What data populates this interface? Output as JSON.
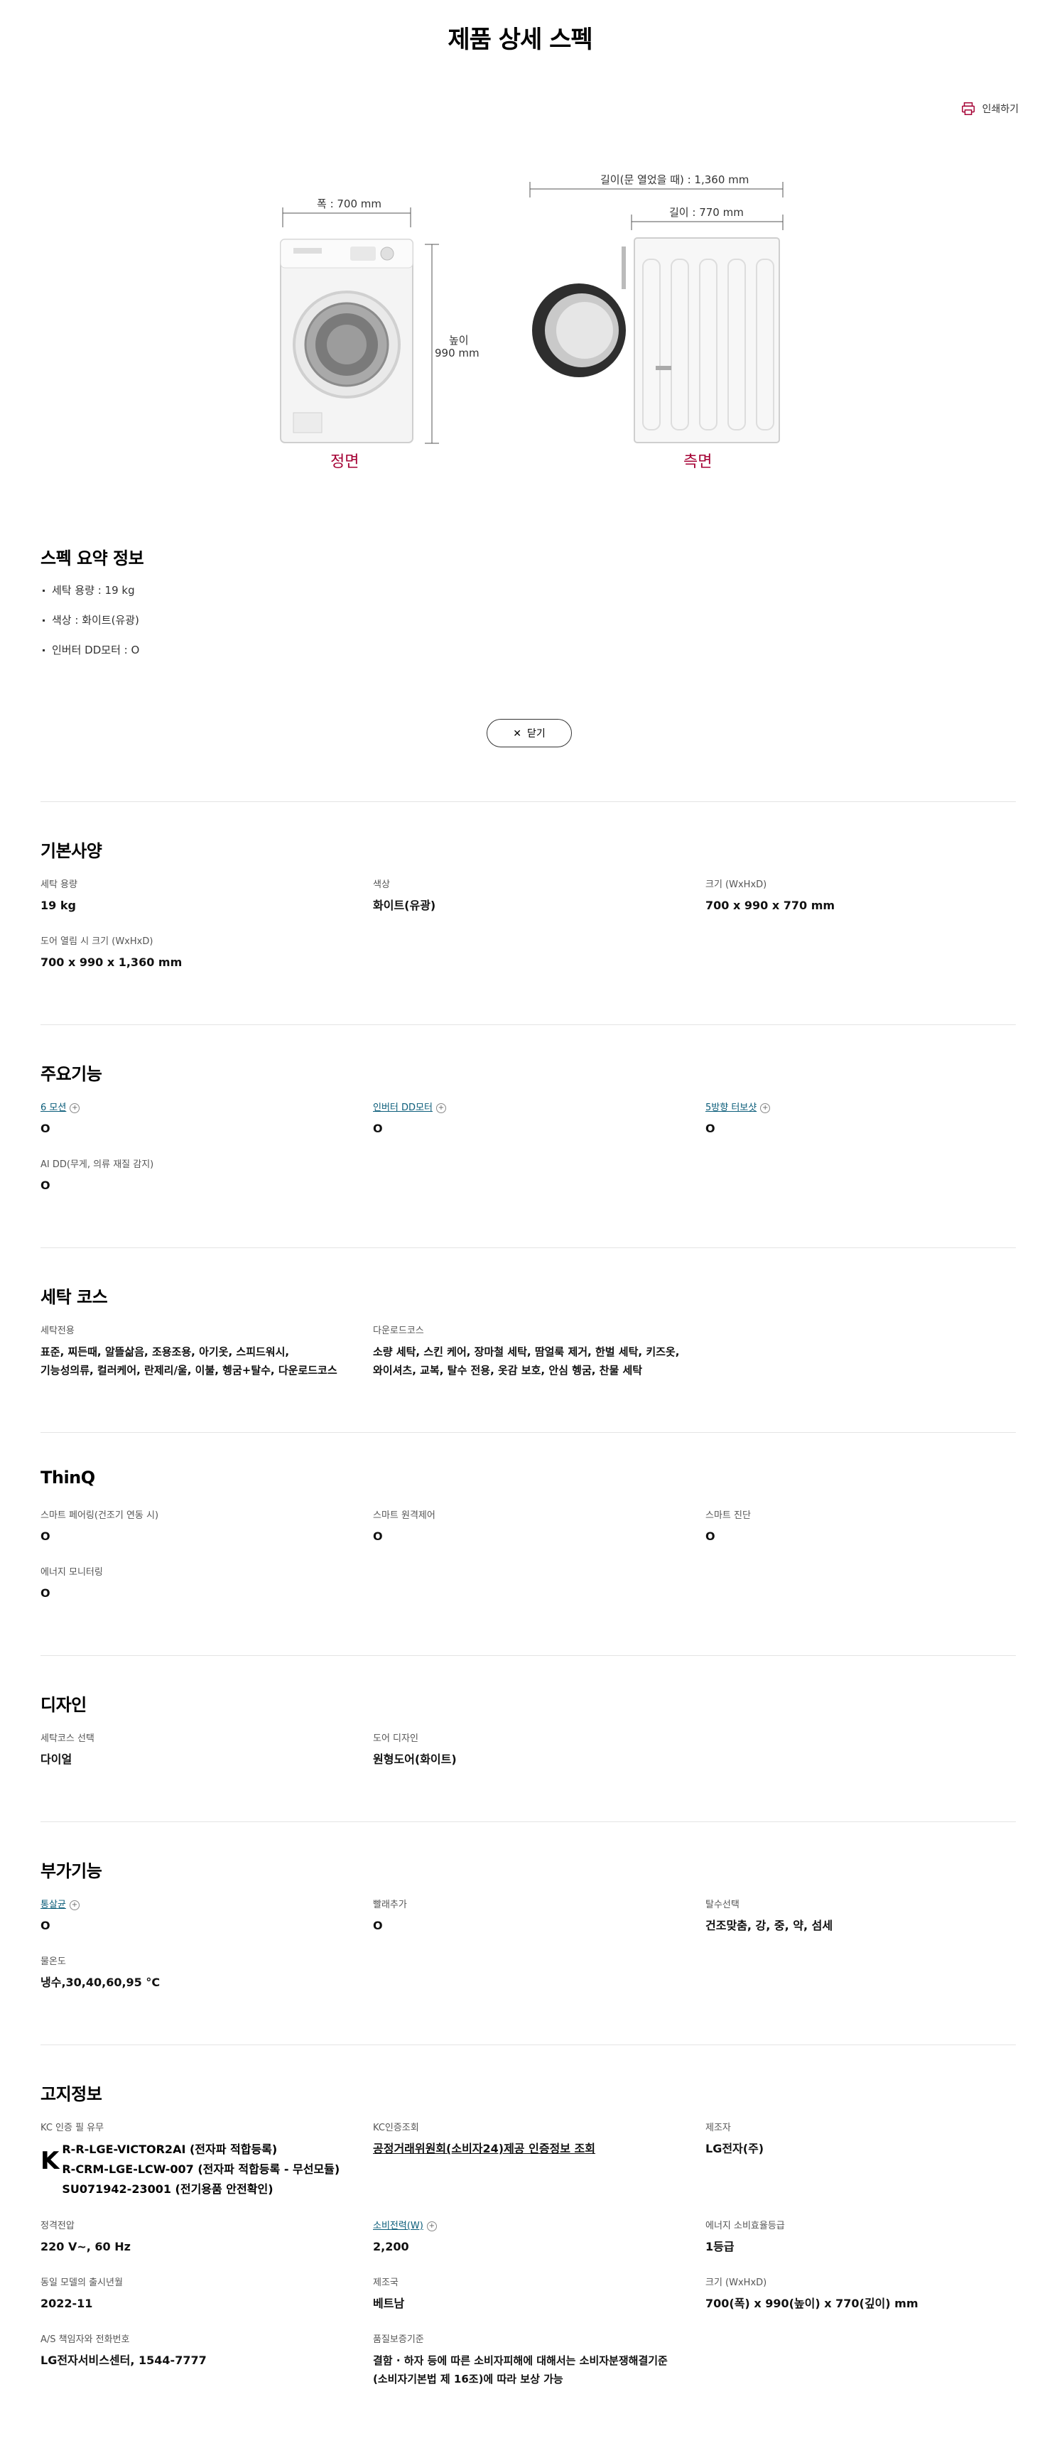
{
  "page": {
    "title": "제품 상세 스펙",
    "print_label": "인쇄하기"
  },
  "diagram": {
    "width_label": "폭 : 700 mm",
    "height_label_1": "높이",
    "height_label_2": "990 mm",
    "door_open_label": "길이(문 열었을 때) : 1,360 mm",
    "depth_label": "길이 : 770 mm",
    "front_caption": "정면",
    "side_caption": "측면"
  },
  "summary": {
    "title": "스펙 요약 정보",
    "items": [
      "세탁 용량 : 19 kg",
      "색상 : 화이트(유광)",
      "인버터 DD모터 : O"
    ],
    "close_label": "닫기"
  },
  "sections": {
    "basic": {
      "title": "기본사양",
      "items": [
        {
          "label": "세탁 용량",
          "value": "19 kg"
        },
        {
          "label": "색상",
          "value": "화이트(유광)"
        },
        {
          "label": "크기 (WxHxD)",
          "value": "700 x 990 x 770 mm"
        },
        {
          "label": "도어 열림 시 크기 (WxHxD)",
          "value": "700 x 990 x 1,360 mm"
        }
      ]
    },
    "features": {
      "title": "주요기능",
      "items": [
        {
          "label": "6 모션",
          "value": "O"
        },
        {
          "label": "인버터 DD모터",
          "value": "O"
        },
        {
          "label": "5방향 터보샷",
          "value": "O"
        },
        {
          "label": "AI DD(무게, 의류 재질 감지)",
          "value": "O"
        }
      ]
    },
    "courses": {
      "title": "세탁 코스",
      "items": [
        {
          "label": "세탁전용",
          "value_1": "표준, 찌든때, 알뜰삶음, 조용조용, 아기옷, 스피드워시,",
          "value_2": "기능성의류, 컬러케어, 란제리/울, 이불, 헹굼+탈수, 다운로드코스"
        },
        {
          "label": "다운로드코스",
          "value_1": "소량 세탁, 스킨 케어, 장마철 세탁, 땀얼룩 제거, 한벌 세탁, 키즈옷,",
          "value_2": "와이셔츠, 교복, 탈수 전용, 옷감 보호, 안심 헹굼, 찬물 세탁"
        }
      ]
    },
    "thinq": {
      "title": "ThinQ",
      "items": [
        {
          "label": "스마트 페어링(건조기 연동 시)",
          "value": "O"
        },
        {
          "label": "스마트 원격제어",
          "value": "O"
        },
        {
          "label": "스마트 진단",
          "value": "O"
        },
        {
          "label": "에너지 모니터링",
          "value": "O"
        }
      ]
    },
    "design": {
      "title": "디자인",
      "items": [
        {
          "label": "세탁코스 선택",
          "value": "다이얼"
        },
        {
          "label": "도어 디자인",
          "value": "원형도어(화이트)"
        }
      ]
    },
    "extra": {
      "title": "부가기능",
      "items": [
        {
          "label": "통살균",
          "value": "O"
        },
        {
          "label": "빨래추가",
          "value": "O"
        },
        {
          "label": "탈수선택",
          "value": "건조맞춤, 강, 중, 약, 섬세"
        },
        {
          "label": "물온도",
          "value": "냉수,30,40,60,95 °C"
        }
      ]
    },
    "notice": {
      "title": "고지정보",
      "kc_label": "KC 인증 필 유무",
      "kc_lines": [
        "R-R-LGE-VICTOR2AI (전자파 적합등록)",
        "R-CRM-LGE-LCW-007 (전자파 적합등록 - 무선모듈)",
        "SU071942-23001 (전기용품 안전확인)"
      ],
      "kc_logo": "K",
      "kc_lookup_label": "KC인증조회",
      "kc_lookup_value": "공정거래위원회(소비자24)제공 인증정보 조회",
      "maker_label": "제조자",
      "maker_value": "LG전자(주)",
      "voltage_label": "정격전압",
      "voltage_value": "220 V~, 60 Hz",
      "power_label": "소비전력(W)",
      "power_value": "2,200",
      "energy_label": "에너지 소비효율등급",
      "energy_value": "1등급",
      "release_label": "동일 모델의 출시년월",
      "release_value": "2022-11",
      "country_label": "제조국",
      "country_value": "베트남",
      "size_label": "크기 (WxHxD)",
      "size_value": "700(폭) x 990(높이) x 770(깊이) mm",
      "as_label": "A/S 책임자와 전화번호",
      "as_value": "LG전자서비스센터, 1544-7777",
      "warranty_label": "품질보증기준",
      "warranty_value_1": "결함 · 하자 등에 따른 소비자피해에 대해서는 소비자분쟁해결기준",
      "warranty_value_2": "(소비자기본법 제 16조)에 따라 보상 가능"
    }
  },
  "colors": {
    "accent": "#a50034",
    "link": "#0b5d7a",
    "divider": "#e4e4e4"
  }
}
